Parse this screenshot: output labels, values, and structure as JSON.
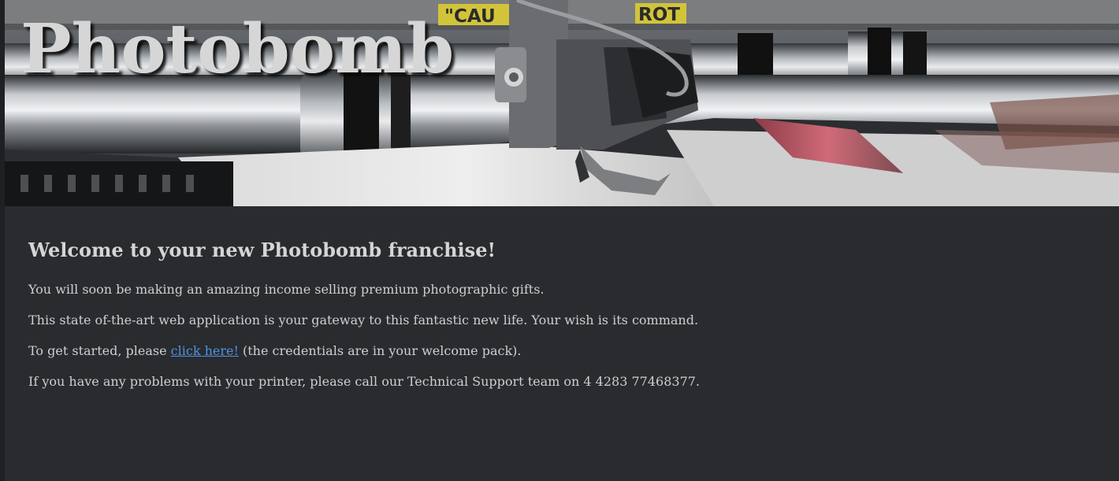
{
  "hero": {
    "title": "Photobomb",
    "image_description": "newspaper printing press"
  },
  "content": {
    "heading": "Welcome to your new Photobomb franchise!",
    "paragraph_1": "You will soon be making an amazing income selling premium photographic gifts.",
    "paragraph_2": "This state of-the-art web application is your gateway to this fantastic new life. Your wish is its command.",
    "paragraph_3": {
      "before": "To get started, please ",
      "link": "click here!",
      "after": " (the credentials are in your welcome pack)."
    },
    "paragraph_4": "If you have any problems with your printer, please call our Technical Support team on 4 4283 77468377."
  },
  "colors": {
    "background": "#292b2f",
    "text": "#cfcfcf",
    "link": "#4f94e0",
    "title": "#d6d6d6"
  }
}
